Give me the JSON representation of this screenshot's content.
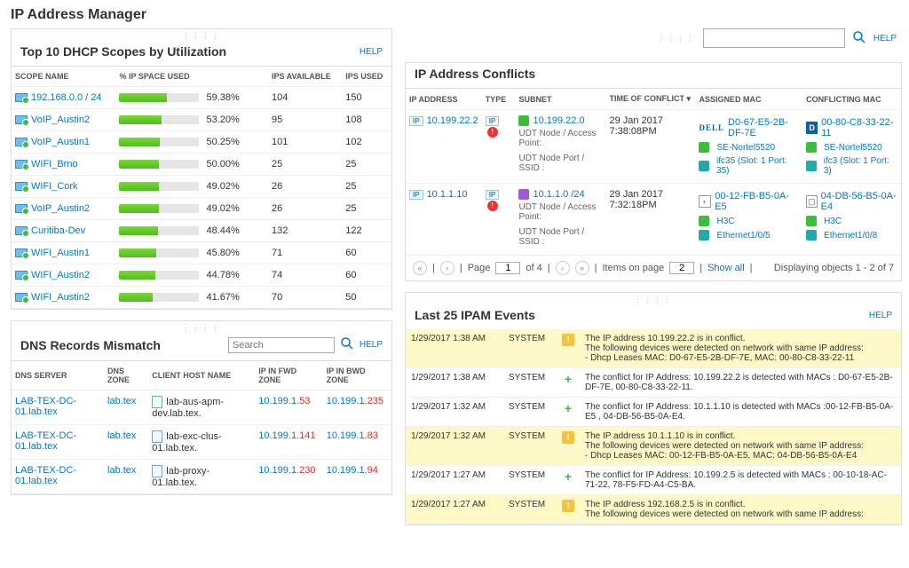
{
  "page_title": "IP Address Manager",
  "help_label": "HELP",
  "search_placeholder": "Search",
  "dhcp": {
    "title": "Top 10 DHCP Scopes by Utilization",
    "cols": [
      "SCOPE NAME",
      "% IP SPACE USED",
      "IPS AVAILABLE",
      "IPS USED"
    ],
    "rows": [
      {
        "name": "192.168.0.0 / 24",
        "pct": "59.38%",
        "avail": "104",
        "used": "150"
      },
      {
        "name": "VoIP_Austin2",
        "pct": "53.20%",
        "avail": "95",
        "used": "108"
      },
      {
        "name": "VoIP_Austin1",
        "pct": "50.25%",
        "avail": "101",
        "used": "102"
      },
      {
        "name": "WIFI_Brno",
        "pct": "50.00%",
        "avail": "25",
        "used": "25"
      },
      {
        "name": "WIFI_Cork",
        "pct": "49.02%",
        "avail": "26",
        "used": "25"
      },
      {
        "name": "VoIP_Austin2",
        "pct": "49.02%",
        "avail": "26",
        "used": "25"
      },
      {
        "name": "Curitiba-Dev",
        "pct": "48.44%",
        "avail": "132",
        "used": "122"
      },
      {
        "name": "WIFI_Austin1",
        "pct": "45.80%",
        "avail": "71",
        "used": "60"
      },
      {
        "name": "WIFI_Austin2",
        "pct": "44.78%",
        "avail": "74",
        "used": "60"
      },
      {
        "name": "WIFI_Austin2",
        "pct": "41.67%",
        "avail": "70",
        "used": "50"
      }
    ]
  },
  "dns": {
    "title": "DNS Records Mismatch",
    "cols": [
      "DNS SERVER",
      "DNS ZONE",
      "CLIENT HOST NAME",
      "IP IN FWD ZONE",
      "IP IN BWD ZONE"
    ],
    "rows": [
      {
        "server": "LAB-TEX-DC-01.lab.tex",
        "zone": "lab.tex",
        "host": "lab-aus-apm-dev.lab.tex.",
        "fwd_base": "10.199.1.",
        "fwd_tail": "53",
        "bwd_base": "10.199.1.",
        "bwd_tail": "235"
      },
      {
        "server": "LAB-TEX-DC-01.lab.tex",
        "zone": "lab.tex",
        "host": "lab-exc-clus-01.lab.tex.",
        "fwd_base": "10.199.1.",
        "fwd_tail": "141",
        "bwd_base": "10.199.1.",
        "bwd_tail": "83"
      },
      {
        "server": "LAB-TEX-DC-01.lab.tex",
        "zone": "lab.tex",
        "host": "lab-proxy-01.lab.tex.",
        "fwd_base": "10.199.1.",
        "fwd_tail": "230",
        "bwd_base": "10.199.1.",
        "bwd_tail": "94"
      }
    ]
  },
  "conflicts": {
    "title": "IP Address Conflicts",
    "cols": [
      "IP ADDRESS",
      "TYPE",
      "SUBNET",
      "TIME OF CONFLICT ▾",
      "ASSIGNED MAC",
      "CONFLICTING MAC"
    ],
    "udt_node": "UDT Node / Access Point:",
    "udt_port": "UDT Node Port / SSID :",
    "rows": [
      {
        "ip": "10.199.22.2",
        "subnet": "10.199.22.0",
        "time": "29 Jan 2017 7:38:08PM",
        "mac_a": "D0-67-E5-2B-DF-7E",
        "vendor_a": "dell",
        "dev_a": "SE-Nortel5520",
        "port_a": "ifc35 (Slot: 1 Port: 35)",
        "mac_c": "00-80-C8-33-22-11",
        "vendor_c": "D",
        "dev_c": "SE-Nortel5520",
        "port_c": "ifc3 (Slot: 1 Port: 3)"
      },
      {
        "ip": "10.1.1.10",
        "subnet": "10.1.1.0 /24",
        "time": "29 Jan 2017 7:32:18PM",
        "mac_a": "00-12-FB-B5-0A-E5",
        "vendor_a": "disc",
        "dev_a": "H3C",
        "port_a": "Ethernet1/0/5",
        "mac_c": "04-DB-56-B5-0A-E4",
        "vendor_c": "sq",
        "dev_c": "H3C",
        "port_c": "Ethernet1/0/8"
      }
    ],
    "pager": {
      "page": "1",
      "of": "of 4",
      "items_label": "Items on page",
      "items": "2",
      "showall": "Show all",
      "page_label": "Page",
      "display": "Displaying objects 1 - 2 of 7"
    }
  },
  "events": {
    "title": "Last 25 IPAM Events",
    "rows": [
      {
        "t": "1/29/2017 1:38 AM",
        "src": "SYSTEM",
        "type": "warn",
        "msg": "The IP address 10.199.22.2 is in conflict.\nThe following devices were detected on network with same IP address:\n- Dhcp Leases MAC: D0-67-E5-2B-DF-7E, MAC: 00-80-C8-33-22-11"
      },
      {
        "t": "1/29/2017 1:38 AM",
        "src": "SYSTEM",
        "type": "ok",
        "msg": "The conflict for IP Address: 10.199.22.2 is detected with MACs : D0-67-E5-2B-DF-7E, 00-80-C8-33-22-11."
      },
      {
        "t": "1/29/2017 1:32 AM",
        "src": "SYSTEM",
        "type": "ok",
        "msg": "The conflict for IP Address: 10.1.1.10 is detected with MACs :00-12-FB-B5-0A-E5 , 04-DB-56-B5-0A-E4."
      },
      {
        "t": "1/29/2017 1:32 AM",
        "src": "SYSTEM",
        "type": "warn",
        "msg": "The IP address 10.1.1.10 is in conflict.\nThe following devices were detected on network with same IP address:\n- Dhcp Leases MAC: 00-12-FB-B5-0A-E5, MAC: 04-DB-56-B5-0A-E4"
      },
      {
        "t": "1/29/2017 1:27 AM",
        "src": "SYSTEM",
        "type": "ok",
        "msg": "The conflict for IP Address: 10.199.2.5 is detected with MACs : 00-10-18-AC-71-22, 78-F5-FD-A4-C5-BA."
      },
      {
        "t": "1/29/2017 1:27 AM",
        "src": "SYSTEM",
        "type": "warn",
        "msg": "The IP address 192.168.2.5 is in conflict.\nThe following devices were detected on network with same IP address:"
      }
    ]
  }
}
